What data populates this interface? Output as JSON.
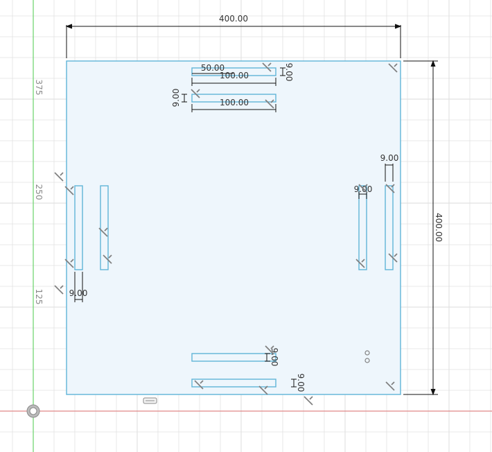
{
  "colors": {
    "background": "#ffffff",
    "grid": "#e2e2e2",
    "sketch_line": "#5fb4d8",
    "sketch_fill": "#eef6fc",
    "dimension": "#111111",
    "constraint": "#808080",
    "axis_x": "#e07070",
    "axis_y": "#6cd66c"
  },
  "axis_labels": [
    "375",
    "250",
    "125"
  ],
  "dimensions": {
    "width_top": "400.00",
    "height_right": "400.00",
    "top_slot_offset": "50.00",
    "top_slot1_length": "100.00",
    "top_slot2_length": "100.00",
    "top_slot1_thickness": "9.00",
    "top_slot2_thickness": "9.00",
    "right_slot_outer_width": "9.00",
    "right_slot_inner_width": "9.00",
    "left_slot_width": "9.00",
    "bottom_slot1_thickness": "9.00",
    "bottom_slot2_thickness": "9.00"
  },
  "icons": {
    "origin": "origin-icon",
    "sketch_palette": "sketch-palette-icon",
    "point_pair": "point-pair-icon",
    "constraint": "horizontal-vertical-constraint-icon"
  }
}
